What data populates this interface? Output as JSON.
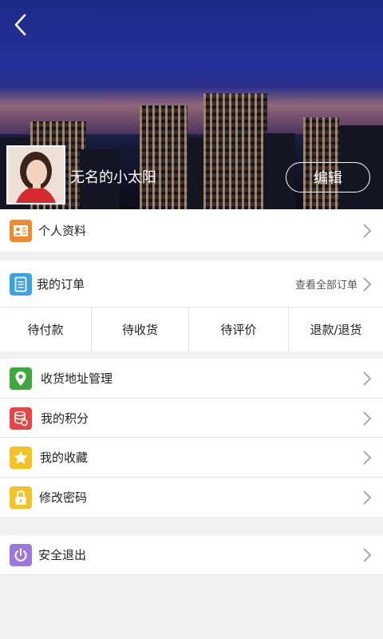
{
  "header": {
    "username": "无名的小太阳",
    "edit_label": "编辑"
  },
  "profile_row": {
    "label": "个人资料",
    "icon": "profile-card-icon",
    "color": "#f08a2c"
  },
  "orders": {
    "title": "我的订单",
    "view_all": "查看全部订单",
    "icon": "order-list-icon",
    "color": "#3aa3e3",
    "tabs": [
      "待付款",
      "待收货",
      "待评价",
      "退款/退货"
    ]
  },
  "menu": [
    {
      "label": "收货地址管理",
      "icon": "location-pin-icon",
      "color": "#3da83b"
    },
    {
      "label": "我的积分",
      "icon": "coins-icon",
      "color": "#e84545"
    },
    {
      "label": "我的收藏",
      "icon": "star-icon",
      "color": "#f5c324"
    },
    {
      "label": "修改密码",
      "icon": "lock-icon",
      "color": "#f5c324"
    }
  ],
  "logout": {
    "label": "安全退出",
    "icon": "power-icon",
    "color": "#9b78e0"
  }
}
